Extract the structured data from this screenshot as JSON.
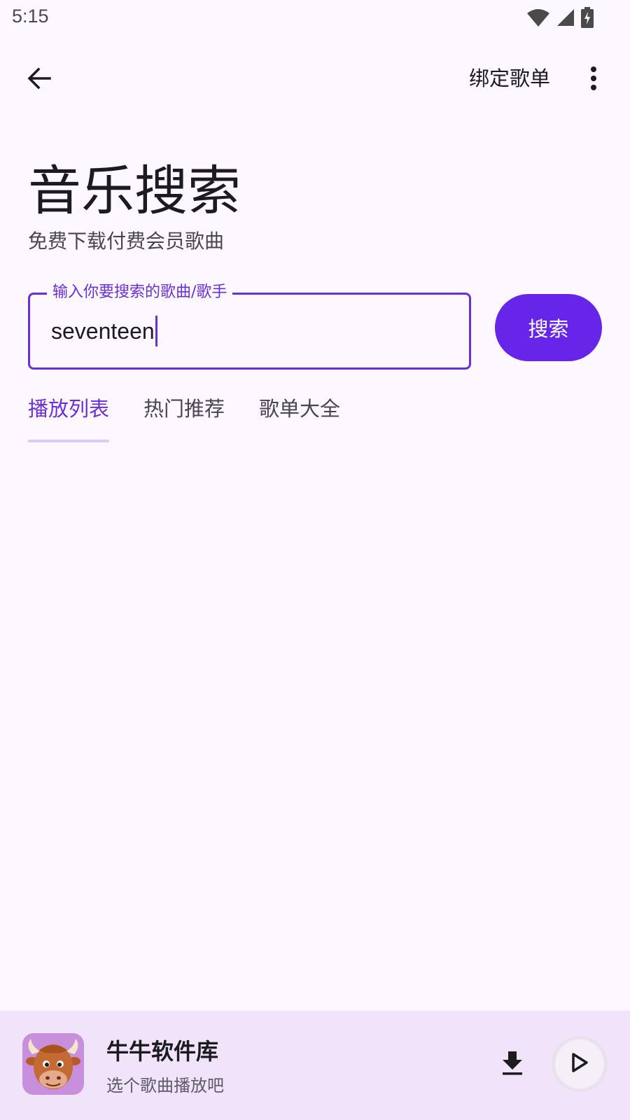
{
  "status_bar": {
    "time": "5:15",
    "icons": [
      "wifi-icon",
      "signal-icon",
      "battery-charging-icon"
    ]
  },
  "app_bar": {
    "back_icon": "arrow-back-icon",
    "bind_label": "绑定歌单",
    "more_icon": "more-vert-icon"
  },
  "header": {
    "title": "音乐搜索",
    "subtitle": "免费下载付费会员歌曲"
  },
  "search": {
    "label": "输入你要搜索的歌曲/歌手",
    "value": "seventeen",
    "button_label": "搜索"
  },
  "tabs": [
    {
      "label": "播放列表",
      "active": true
    },
    {
      "label": "热门推荐",
      "active": false
    },
    {
      "label": "歌单大全",
      "active": false
    }
  ],
  "player": {
    "title": "牛牛软件库",
    "subtitle": "选个歌曲播放吧",
    "download_icon": "download-icon",
    "play_icon": "play-icon"
  },
  "colors": {
    "accent": "#6a30d8",
    "button": "#6625e8",
    "background": "#fdf7ff",
    "player_background": "#f0e3fa"
  }
}
